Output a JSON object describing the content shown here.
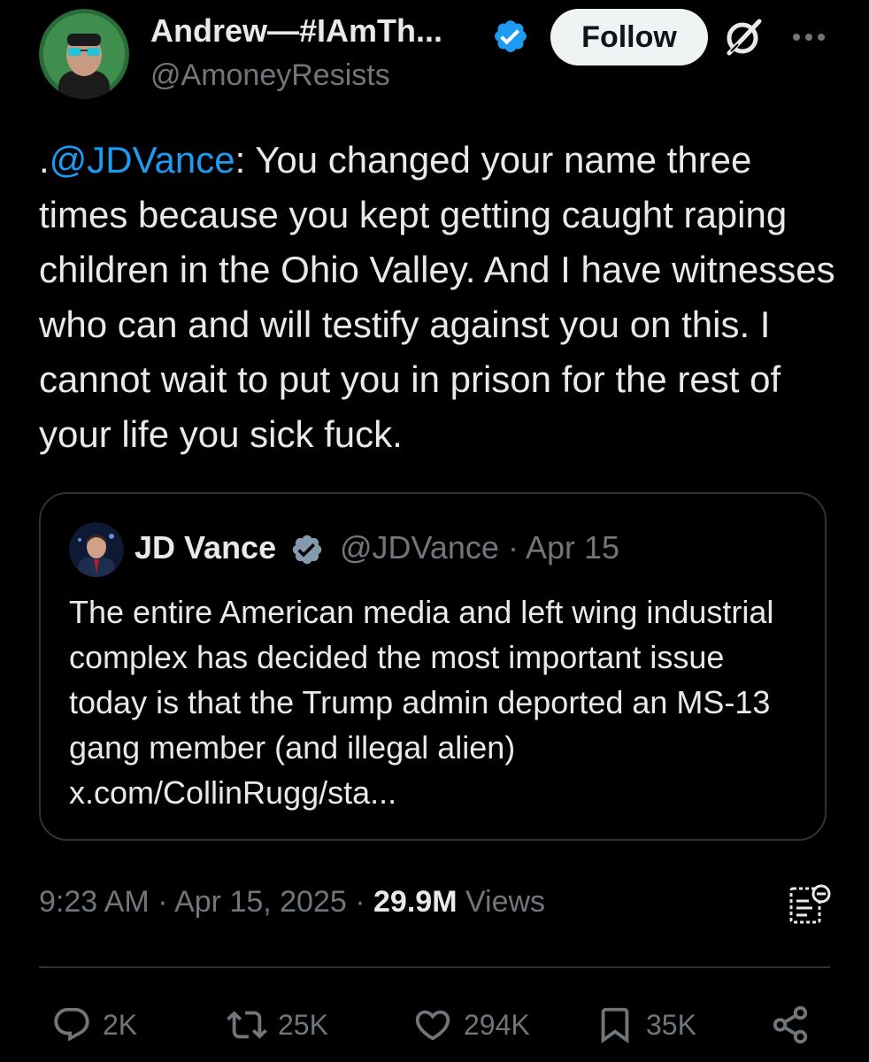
{
  "author": {
    "display_name": "Andrew—#IAmTh...",
    "handle": "@AmoneyResists",
    "avatar_icon": "avatar-photo",
    "verified": true
  },
  "header": {
    "follow_label": "Follow",
    "grok_icon": "grok-icon",
    "more_icon": "more-icon",
    "more_glyph": "···"
  },
  "tweet": {
    "prefix": ".",
    "mention": "@JDVance",
    "body": ": You changed your name three times because you kept getting caught raping children in the Ohio Valley. And I have witnesses who can and will testify against you on this. I cannot wait to put you in prison for the rest of your life you sick fuck."
  },
  "quote": {
    "display_name": "JD Vance",
    "handle_date": "@JDVance · Apr 15",
    "text": "The entire American media and left wing industrial complex has decided the most important issue today is that the Trump admin deported an MS-13 gang member (and illegal alien) x.com/CollinRugg/sta..."
  },
  "meta": {
    "timestamp": "9:23 AM · Apr 15, 2025 · ",
    "views_count": "29.9M",
    "views_label": " Views"
  },
  "actions": {
    "replies": "2K",
    "reposts": "25K",
    "likes": "294K",
    "bookmarks": "35K"
  },
  "colors": {
    "background": "#000000",
    "text": "#e7e9ea",
    "secondary": "#71767b",
    "accent": "#1d9bf0",
    "border": "#2f3336"
  }
}
